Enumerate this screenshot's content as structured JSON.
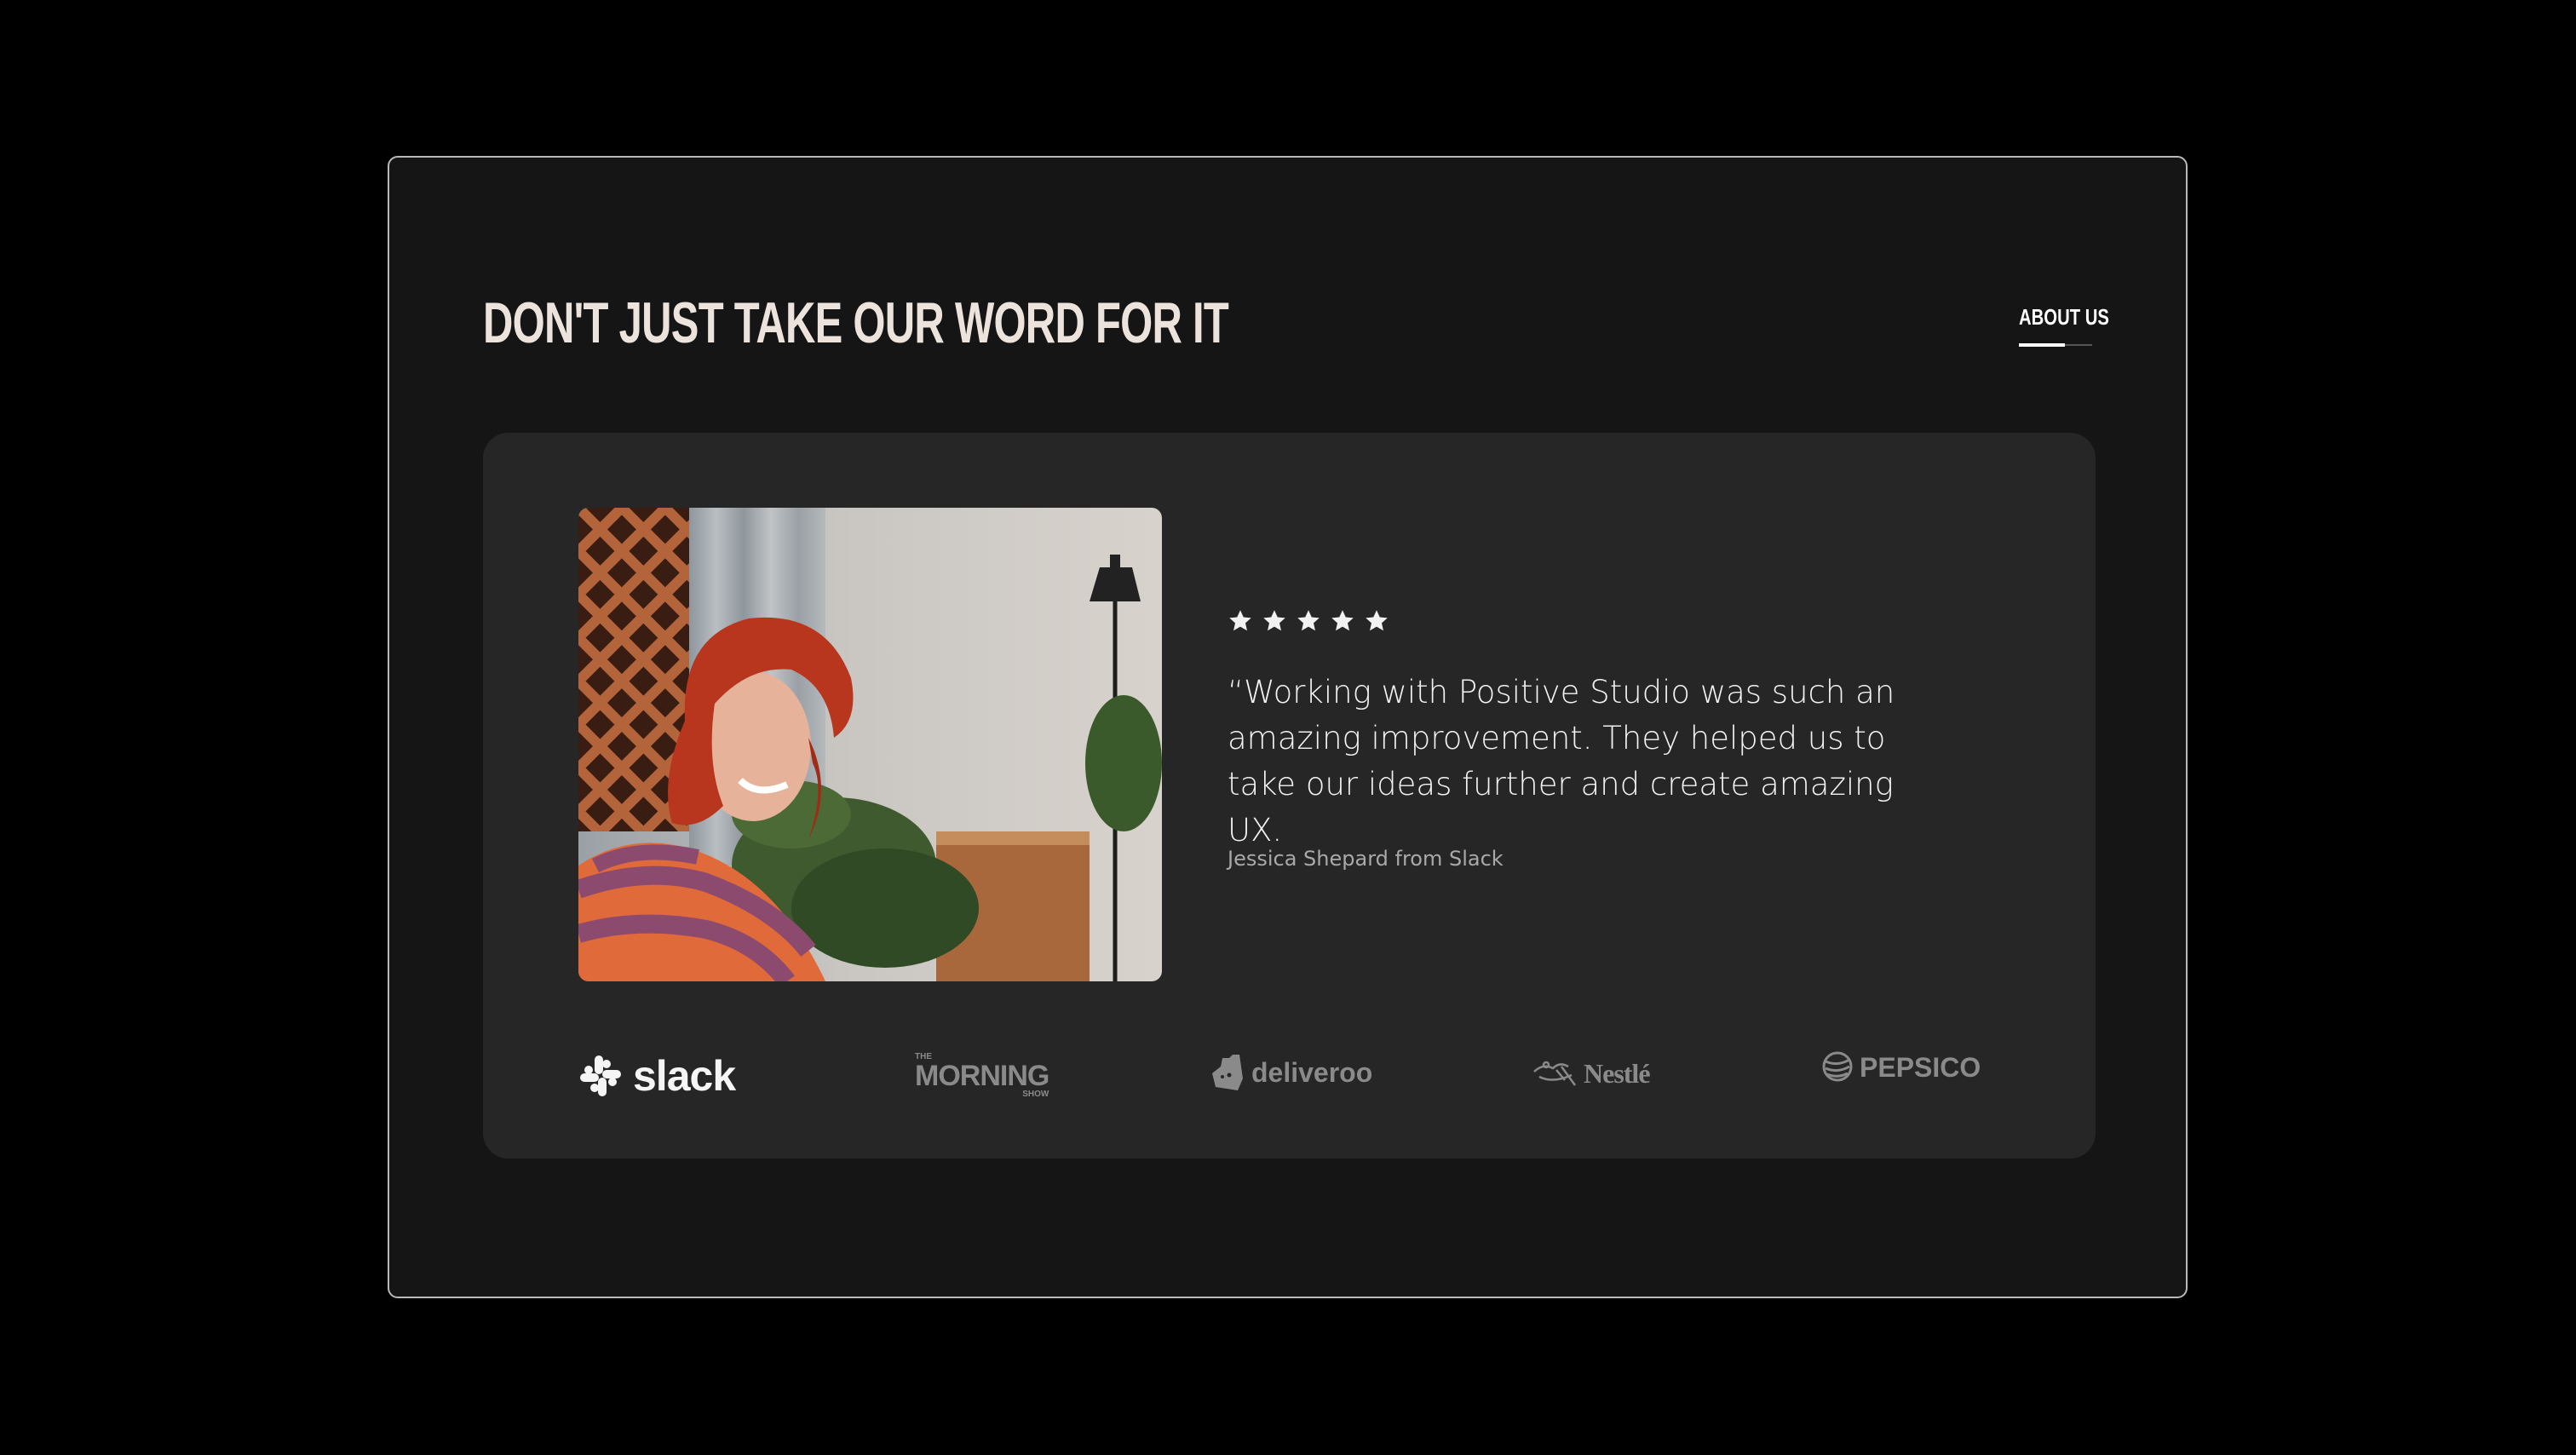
{
  "section": {
    "title": "DON'T JUST TAKE OUR WORD FOR IT",
    "about_link": "ABOUT US"
  },
  "testimonial": {
    "rating": 5,
    "quote": "“Working with Positive Studio was such an amazing improvement. They helped us to take our ideas further and create amazing UX.",
    "author": "Jessica Shepard from Slack"
  },
  "logos": {
    "slack": "slack",
    "morning_top": "THE",
    "morning_main": "MORNING",
    "morning_bottom": "SHOW",
    "deliveroo": "deliveroo",
    "nestle": "Nestlé",
    "pepsico": "PEPSICO"
  },
  "colors": {
    "page_bg": "#000000",
    "frame_bg": "#151515",
    "card_bg": "#262626",
    "title": "#ece4dc",
    "muted_logo": "#8a8a8a"
  }
}
